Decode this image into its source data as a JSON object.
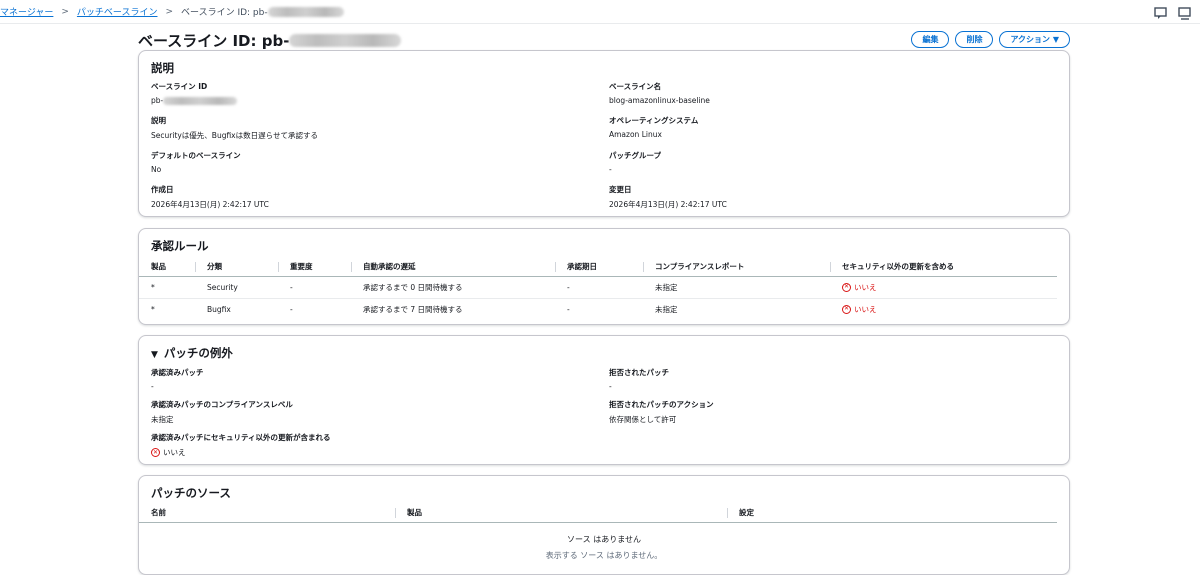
{
  "breadcrumb": {
    "item1": "マネージャー",
    "item2": "パッチベースライン",
    "current_prefix": "ベースライン ID: pb-"
  },
  "header": {
    "title_prefix": "ベースライン ID: pb-",
    "edit": "編集",
    "delete": "削除",
    "actions": "アクション ▼"
  },
  "details": {
    "title": "説明",
    "baseline_id_label": "ベースライン ID",
    "baseline_id_prefix": "pb-",
    "name_label": "ベースライン名",
    "name_value": "blog-amazonlinux-baseline",
    "desc_label": "説明",
    "desc_value": "Securityは優先、Bugfixは数日遅らせて承認する",
    "os_label": "オペレーティングシステム",
    "os_value": "Amazon Linux",
    "default_label": "デフォルトのベースライン",
    "default_value": "No",
    "group_label": "パッチグループ",
    "group_value": "-",
    "created_label": "作成日",
    "created_value": "2026年4月13日(月) 2:42:17 UTC",
    "modified_label": "変更日",
    "modified_value": "2026年4月13日(月) 2:42:17 UTC"
  },
  "rules": {
    "title": "承認ルール",
    "columns": [
      "製品",
      "分類",
      "重要度",
      "自動承認の遅延",
      "承認期日",
      "コンプライアンスレポート",
      "セキュリティ以外の更新を含める"
    ],
    "rows": [
      [
        "*",
        "Security",
        "-",
        "承認するまで 0 日間待機する",
        "-",
        "未指定",
        "いいえ"
      ],
      [
        "*",
        "Bugfix",
        "-",
        "承認するまで 7 日間待機する",
        "-",
        "未指定",
        "いいえ"
      ]
    ]
  },
  "exceptions": {
    "title": "パッチの例外",
    "approved_label": "承認済みパッチ",
    "approved_value": "-",
    "rejected_label": "拒否されたパッチ",
    "rejected_value": "-",
    "compliance_label": "承認済みパッチのコンプライアンスレベル",
    "compliance_value": "未指定",
    "rejected_action_label": "拒否されたパッチのアクション",
    "rejected_action_value": "依存関係として許可",
    "nonsec_label": "承認済みパッチにセキュリティ以外の更新が含まれる",
    "nonsec_value": "いいえ"
  },
  "sources": {
    "title": "パッチのソース",
    "columns": [
      "名前",
      "製品",
      "設定"
    ],
    "empty_title": "ソース はありません",
    "empty_desc": "表示する ソース はありません。"
  },
  "colors": {
    "link": "#0972d3",
    "error": "#d91515",
    "border": "#c6c6cd"
  }
}
